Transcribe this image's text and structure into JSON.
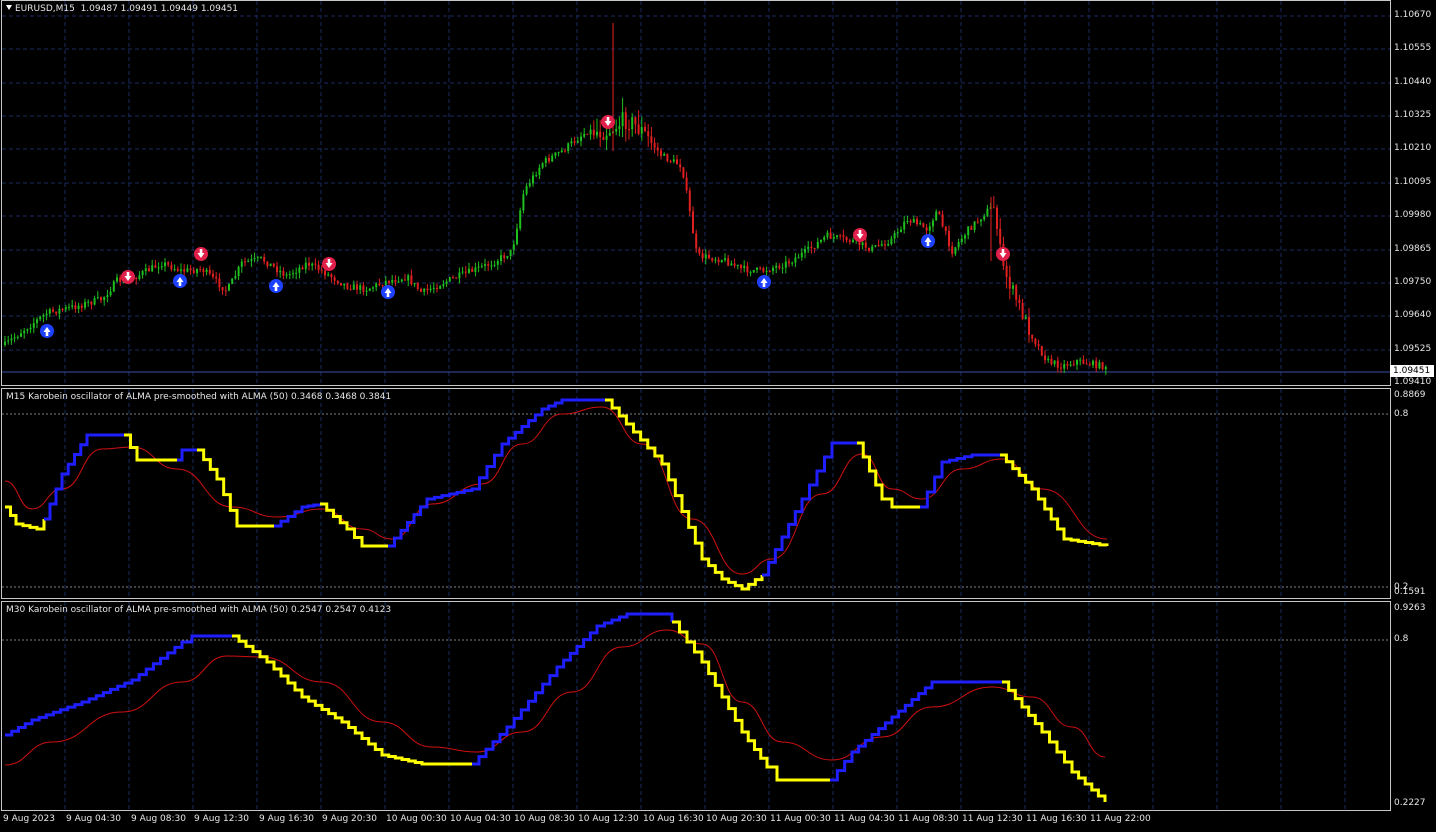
{
  "main_chart": {
    "symbol_tf": "EURUSD,M15",
    "ohlc": "1.09487 1.09491 1.09449 1.09451",
    "price_labels": [
      "1.10670",
      "1.10555",
      "1.10440",
      "1.10325",
      "1.10210",
      "1.10095",
      "1.09980",
      "1.09865",
      "1.09750",
      "1.09640",
      "1.09525",
      "1.09410"
    ],
    "current_price": "1.09451",
    "colors": {
      "bull": "#1fbf1f",
      "bear": "#e02020",
      "grid": "#1c2a60",
      "signal_up": "#1e40ff",
      "signal_down": "#e0204a"
    }
  },
  "osc1": {
    "title": "M15 Karobein oscillator of ALMA pre-smoothed with ALMA  (50) 0.3468 0.3468 0.3841",
    "max_label": "0.8869",
    "level_high": "0.8",
    "level_low": "0.2",
    "min_label": "0.1591"
  },
  "osc2": {
    "title": "M30 Karobein oscillator of ALMA pre-smoothed with ALMA  (50) 0.2547 0.2547 0.4123",
    "max_label": "0.9263",
    "level_high": "0.8",
    "min_label": "0.2227"
  },
  "time_axis": [
    "9 Aug 2023",
    "9 Aug 04:30",
    "9 Aug 08:30",
    "9 Aug 12:30",
    "9 Aug 16:30",
    "9 Aug 20:30",
    "10 Aug 00:30",
    "10 Aug 04:30",
    "10 Aug 08:30",
    "10 Aug 12:30",
    "10 Aug 16:30",
    "10 Aug 20:30",
    "11 Aug 00:30",
    "11 Aug 04:30",
    "11 Aug 08:30",
    "11 Aug 12:30",
    "11 Aug 16:30",
    "11 Aug 22:00"
  ],
  "legend_colors": {
    "osc_up": "#1e1eff",
    "osc_down": "#ffff00",
    "signal_line": "#d01010"
  }
}
